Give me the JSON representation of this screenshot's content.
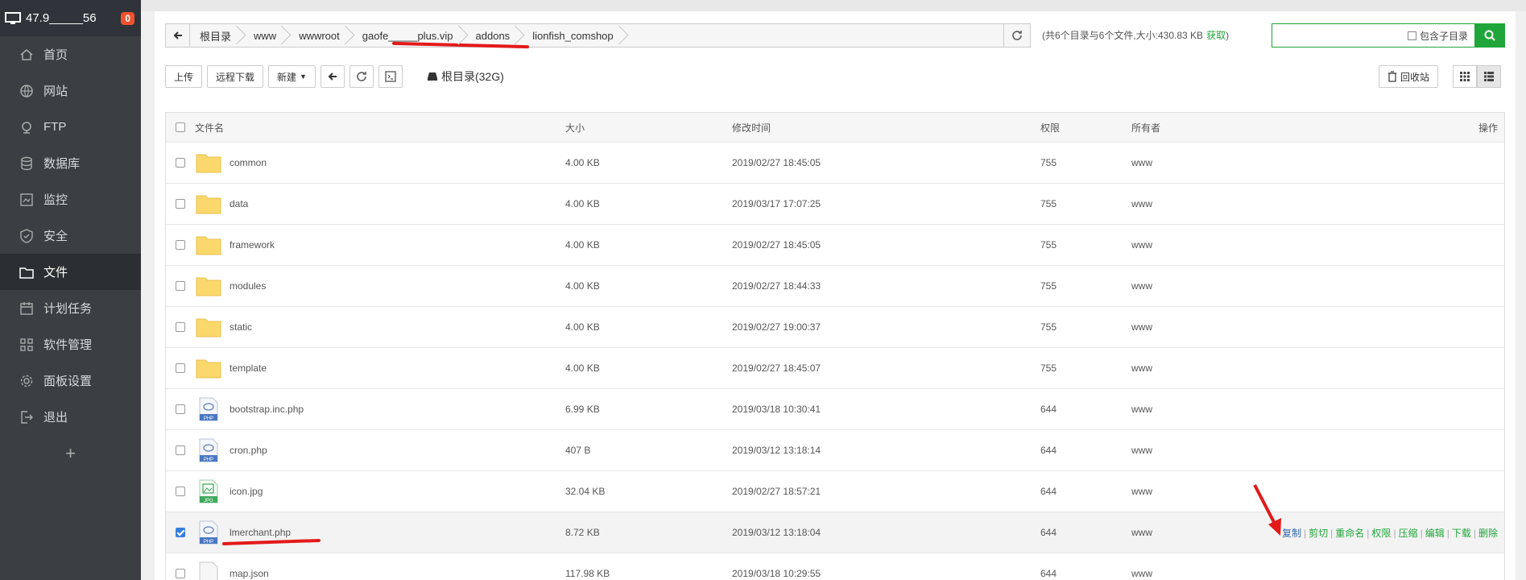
{
  "sidebar": {
    "host": "47.9_____56",
    "badge": "0",
    "items": [
      {
        "label": "首页",
        "icon": "home-icon"
      },
      {
        "label": "网站",
        "icon": "globe-icon"
      },
      {
        "label": "FTP",
        "icon": "ftp-icon"
      },
      {
        "label": "数据库",
        "icon": "database-icon"
      },
      {
        "label": "监控",
        "icon": "monitor-icon"
      },
      {
        "label": "安全",
        "icon": "shield-icon"
      },
      {
        "label": "文件",
        "icon": "folder-icon",
        "active": true
      },
      {
        "label": "计划任务",
        "icon": "calendar-icon"
      },
      {
        "label": "软件管理",
        "icon": "apps-icon"
      },
      {
        "label": "面板设置",
        "icon": "gear-icon"
      },
      {
        "label": "退出",
        "icon": "logout-icon"
      }
    ],
    "plus": "+"
  },
  "path": {
    "crumbs": [
      "根目录",
      "www",
      "wwwroot",
      "gaofe_____plus.vip",
      "addons",
      "lionfish_comshop"
    ]
  },
  "summary": {
    "text": "(共6个目录与6个文件,大小:430.83 KB",
    "get": "获取",
    "close": ")"
  },
  "search": {
    "placeholder": "",
    "subdir_label": "包含子目录"
  },
  "toolbar": {
    "upload": "上传",
    "remote": "远程下载",
    "new": "新建",
    "disk": "根目录(32G)",
    "recycle": "回收站"
  },
  "table": {
    "headers": {
      "name": "文件名",
      "size": "大小",
      "time": "修改时间",
      "perm": "权限",
      "owner": "所有者",
      "ops": "操作"
    },
    "rows": [
      {
        "name": "common",
        "type": "folder",
        "size": "4.00 KB",
        "time": "2019/02/27 18:45:05",
        "perm": "755",
        "owner": "www"
      },
      {
        "name": "data",
        "type": "folder",
        "size": "4.00 KB",
        "time": "2019/03/17 17:07:25",
        "perm": "755",
        "owner": "www"
      },
      {
        "name": "framework",
        "type": "folder",
        "size": "4.00 KB",
        "time": "2019/02/27 18:45:05",
        "perm": "755",
        "owner": "www"
      },
      {
        "name": "modules",
        "type": "folder",
        "size": "4.00 KB",
        "time": "2019/02/27 18:44:33",
        "perm": "755",
        "owner": "www"
      },
      {
        "name": "static",
        "type": "folder",
        "size": "4.00 KB",
        "time": "2019/02/27 19:00:37",
        "perm": "755",
        "owner": "www"
      },
      {
        "name": "template",
        "type": "folder",
        "size": "4.00 KB",
        "time": "2019/02/27 18:45:07",
        "perm": "755",
        "owner": "www"
      },
      {
        "name": "bootstrap.inc.php",
        "type": "php",
        "size": "6.99 KB",
        "time": "2019/03/18 10:30:41",
        "perm": "644",
        "owner": "www"
      },
      {
        "name": "cron.php",
        "type": "php",
        "size": "407 B",
        "time": "2019/03/12 13:18:14",
        "perm": "644",
        "owner": "www"
      },
      {
        "name": "icon.jpg",
        "type": "jpg",
        "size": "32.04 KB",
        "time": "2019/02/27 18:57:21",
        "perm": "644",
        "owner": "www"
      },
      {
        "name": "lmerchant.php",
        "type": "php",
        "size": "8.72 KB",
        "time": "2019/03/12 13:18:04",
        "perm": "644",
        "owner": "www",
        "selected": true
      },
      {
        "name": "map.json",
        "type": "file",
        "size": "117.98 KB",
        "time": "2019/03/18 10:29:55",
        "perm": "644",
        "owner": "www"
      }
    ],
    "ops": [
      "复制",
      "剪切",
      "重命名",
      "权限",
      "压缩",
      "编辑",
      "下载",
      "删除"
    ]
  },
  "colors": {
    "accent": "#20a53a",
    "sidebar": "#3b3f44",
    "annotation": "#e21a1a",
    "badge": "#f0522e"
  }
}
